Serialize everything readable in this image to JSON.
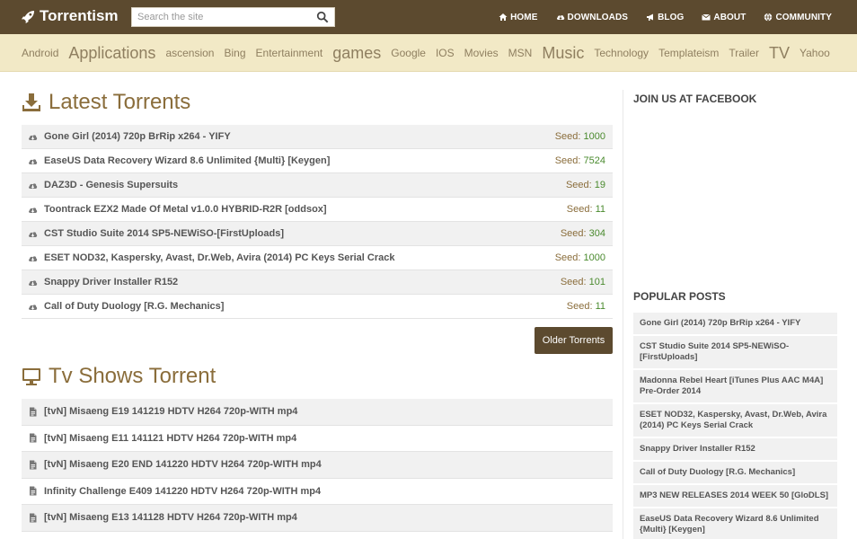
{
  "header": {
    "logo_text": "Torrentism",
    "search_placeholder": "Search the site",
    "nav": [
      {
        "label": "HOME",
        "icon": "home-icon"
      },
      {
        "label": "DOWNLOADS",
        "icon": "cloud-download-icon"
      },
      {
        "label": "BLOG",
        "icon": "megaphone-icon"
      },
      {
        "label": "ABOUT",
        "icon": "envelope-icon"
      },
      {
        "label": "COMMUNITY",
        "icon": "globe-icon"
      }
    ]
  },
  "tags": [
    {
      "label": "Android",
      "size": "small"
    },
    {
      "label": "Applications",
      "size": "large"
    },
    {
      "label": "ascension",
      "size": "small"
    },
    {
      "label": "Bing",
      "size": "small"
    },
    {
      "label": "Entertainment",
      "size": "small"
    },
    {
      "label": "games",
      "size": "large"
    },
    {
      "label": "Google",
      "size": "small"
    },
    {
      "label": "IOS",
      "size": "small"
    },
    {
      "label": "Movies",
      "size": "small"
    },
    {
      "label": "MSN",
      "size": "small"
    },
    {
      "label": "Music",
      "size": "large"
    },
    {
      "label": "Technology",
      "size": "small"
    },
    {
      "label": "Templateism",
      "size": "small"
    },
    {
      "label": "Trailer",
      "size": "small"
    },
    {
      "label": "TV",
      "size": "large"
    },
    {
      "label": "Yahoo",
      "size": "small"
    }
  ],
  "latest": {
    "title": "Latest Torrents",
    "seed_label": "Seed:",
    "items": [
      {
        "title": "Gone Girl (2014) 720p BrRip x264 - YIFY",
        "seed": "1000"
      },
      {
        "title": "EaseUS Data Recovery Wizard 8.6 Unlimited {Multi} [Keygen]",
        "seed": "7524"
      },
      {
        "title": "DAZ3D - Genesis Supersuits",
        "seed": "19"
      },
      {
        "title": "Toontrack EZX2 Made Of Metal v1.0.0 HYBRID-R2R [oddsox]",
        "seed": "11"
      },
      {
        "title": "CST Studio Suite 2014 SP5-NEWiSO-[FirstUploads]",
        "seed": "304"
      },
      {
        "title": "ESET NOD32, Kaspersky, Avast, Dr.Web, Avira (2014) PC Keys Serial Crack",
        "seed": "1000"
      },
      {
        "title": "Snappy Driver Installer R152",
        "seed": "101"
      },
      {
        "title": "Call of Duty Duology [R.G. Mechanics]",
        "seed": "11"
      }
    ],
    "older_button": "Older Torrents"
  },
  "tv": {
    "title": "Tv Shows Torrent",
    "items": [
      {
        "title": "[tvN] Misaeng E19 141219 HDTV H264 720p-WITH mp4"
      },
      {
        "title": "[tvN] Misaeng E11 141121 HDTV H264 720p-WITH mp4"
      },
      {
        "title": "[tvN] Misaeng E20 END 141220 HDTV H264 720p-WITH mp4"
      },
      {
        "title": "Infinity Challenge E409 141220 HDTV H264 720p-WITH mp4"
      },
      {
        "title": "[tvN] Misaeng E13 141128 HDTV H264 720p-WITH mp4"
      },
      {
        "title": ""
      }
    ]
  },
  "sidebar": {
    "facebook_title": "JOIN US AT FACEBOOK",
    "popular_title": "POPULAR POSTS",
    "popular": [
      "Gone Girl (2014) 720p BrRip x264 - YIFY",
      "CST Studio Suite 2014 SP5-NEWiSO-[FirstUploads]",
      "Madonna Rebel Heart [iTunes Plus AAC M4A] Pre-Order 2014",
      "ESET NOD32, Kaspersky, Avast, Dr.Web, Avira (2014) PC Keys Serial Crack",
      "Snappy Driver Installer R152",
      "Call of Duty Duology [R.G. Mechanics]",
      "MP3 NEW RELEASES 2014 WEEK 50 [GloDLS]",
      "EaseUS Data Recovery Wizard 8.6 Unlimited {Multi} [Keygen]"
    ]
  },
  "colors": {
    "header_bg": "#5c4a2f",
    "tagbar_bg": "#f2e9c6",
    "accent": "#8a6d3b",
    "seed_green": "#4a8a2e"
  }
}
